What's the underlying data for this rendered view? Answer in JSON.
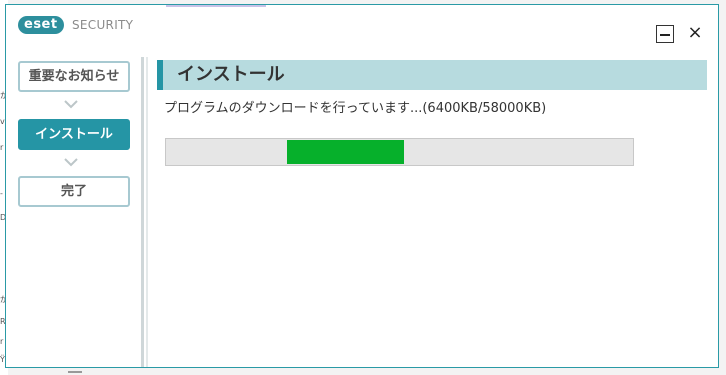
{
  "app": {
    "logo_text": "eset",
    "product_name": "SECURITY"
  },
  "window_controls": {
    "close_glyph": "×",
    "minimize_icon": "minimize-icon"
  },
  "steps": [
    {
      "label": "重要なお知らせ",
      "state": "done"
    },
    {
      "label": "インストール",
      "state": "active"
    },
    {
      "label": "完了",
      "state": "pending"
    }
  ],
  "main": {
    "section_title": "インストール",
    "status_text": "プログラムのダウンロードを行っています...(6400KB/58000KB)",
    "progress": {
      "marquee_start_fraction": 0.26,
      "marquee_length_fraction": 0.25,
      "fill_color": "#06b02b"
    }
  },
  "colors": {
    "accent": "#2595a5",
    "header_band": "#b7dbdf",
    "border": "#2a9aa6"
  }
}
